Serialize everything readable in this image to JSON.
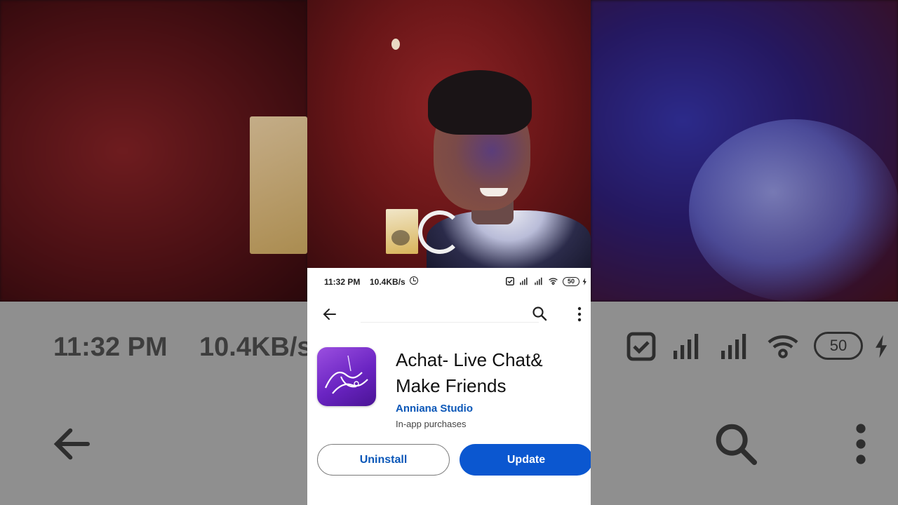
{
  "status_bar": {
    "time": "11:32 PM",
    "network_speed": "10.4KB/s",
    "battery": "50",
    "icons": [
      "clock-icon",
      "checkbox-icon",
      "signal-icon",
      "signal-icon",
      "wifi-icon",
      "battery-icon",
      "charging-icon"
    ]
  },
  "toolbar": {
    "back_icon": "arrow-left-icon",
    "search_icon": "search-icon",
    "menu_icon": "more-vert-icon"
  },
  "app": {
    "title": "Achat- Live Chat& Make Friends",
    "developer": "Anniana Studio",
    "monetization": "In-app purchases",
    "uninstall_label": "Uninstall",
    "update_label": "Update"
  },
  "colors": {
    "accent": "#0b57d0",
    "developer_link": "#0b57b8",
    "app_icon_purple": "#6a24c2"
  }
}
